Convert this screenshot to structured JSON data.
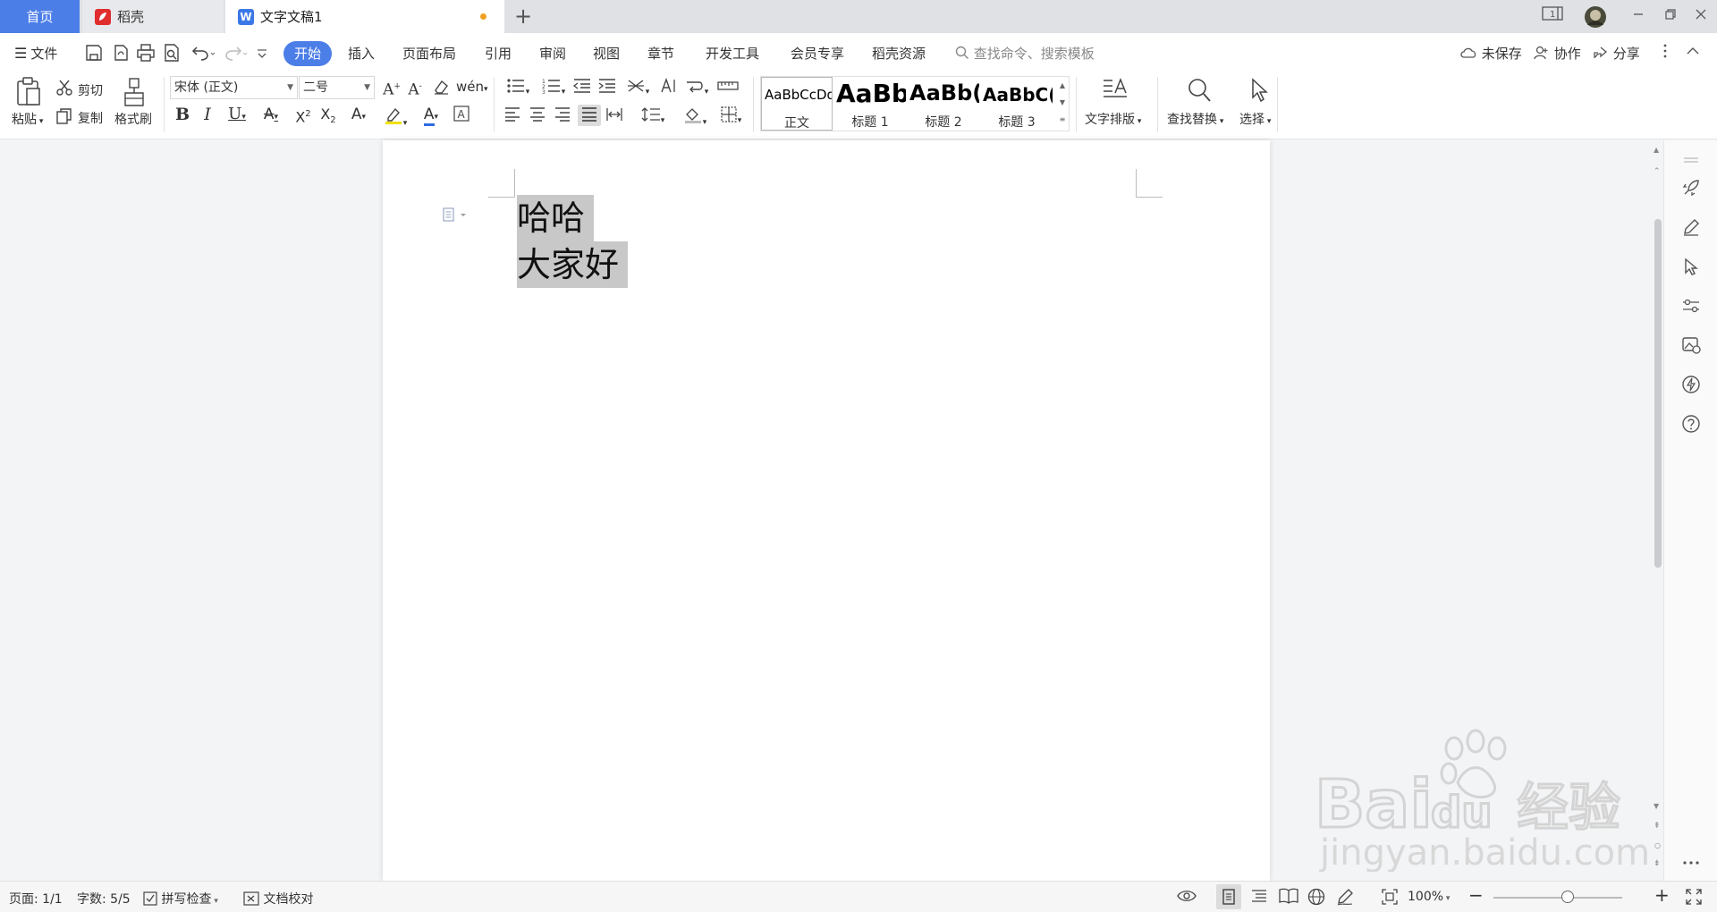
{
  "tabs": {
    "home": "首页",
    "daoke": "稻壳",
    "doc": "文字文稿1",
    "add": "+"
  },
  "window": {
    "layout_badge": "1"
  },
  "menu": {
    "file": "文件",
    "items": [
      "开始",
      "插入",
      "页面布局",
      "引用",
      "审阅",
      "视图",
      "章节",
      "开发工具",
      "会员专享",
      "稻壳资源"
    ],
    "search_placeholder": "查找命令、搜索模板",
    "unsaved": "未保存",
    "collab": "协作",
    "share": "分享"
  },
  "ribbon": {
    "paste": "粘贴",
    "cut": "剪切",
    "copy": "复制",
    "format_painter": "格式刷",
    "font_name": "宋体 (正文)",
    "font_size": "二号",
    "styles": [
      {
        "sample": "AaBbCcDd",
        "name": "正文"
      },
      {
        "sample": "AaBb",
        "name": "标题 1"
      },
      {
        "sample": "AaBb(",
        "name": "标题 2"
      },
      {
        "sample": "AaBbC(",
        "name": "标题 3"
      }
    ],
    "text_layout": "文字排版",
    "find_replace": "查找替换",
    "select": "选择"
  },
  "document": {
    "lines": [
      "哈哈",
      "大家好"
    ]
  },
  "status": {
    "page": "页面: 1/1",
    "words": "字数: 5/5",
    "spell_check": "拼写检查",
    "proofread": "文档校对",
    "zoom": "100%"
  },
  "watermark": {
    "brand": "Bai",
    "brand2": "du",
    "cn": "经验",
    "url": "jingyan.baidu.com"
  },
  "colors": {
    "accent": "#4c7ee8",
    "selection": "#c8c8c8",
    "unsaved_dot": "#f0a020"
  }
}
